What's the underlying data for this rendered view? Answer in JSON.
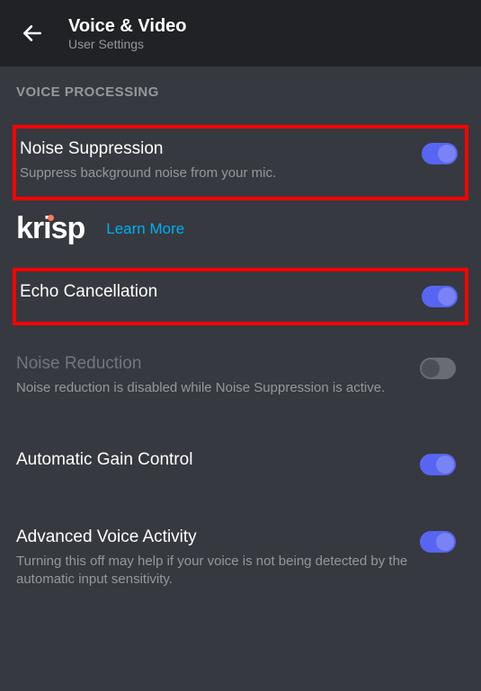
{
  "header": {
    "title": "Voice & Video",
    "subtitle": "User Settings"
  },
  "section_label": "VOICE PROCESSING",
  "noise_suppression": {
    "title": "Noise Suppression",
    "desc": "Suppress background noise from your mic.",
    "enabled": true
  },
  "krisp": {
    "logo_text": "krisp",
    "learn_more": "Learn More"
  },
  "echo_cancellation": {
    "title": "Echo Cancellation",
    "enabled": true
  },
  "noise_reduction": {
    "title": "Noise Reduction",
    "desc": "Noise reduction is disabled while Noise Suppression is active.",
    "enabled": false,
    "interactable": false
  },
  "automatic_gain": {
    "title": "Automatic Gain Control",
    "enabled": true
  },
  "advanced_voice": {
    "title": "Advanced Voice Activity",
    "desc": "Turning this off may help if your voice is not being detected by the automatic input sensitivity.",
    "enabled": true
  }
}
